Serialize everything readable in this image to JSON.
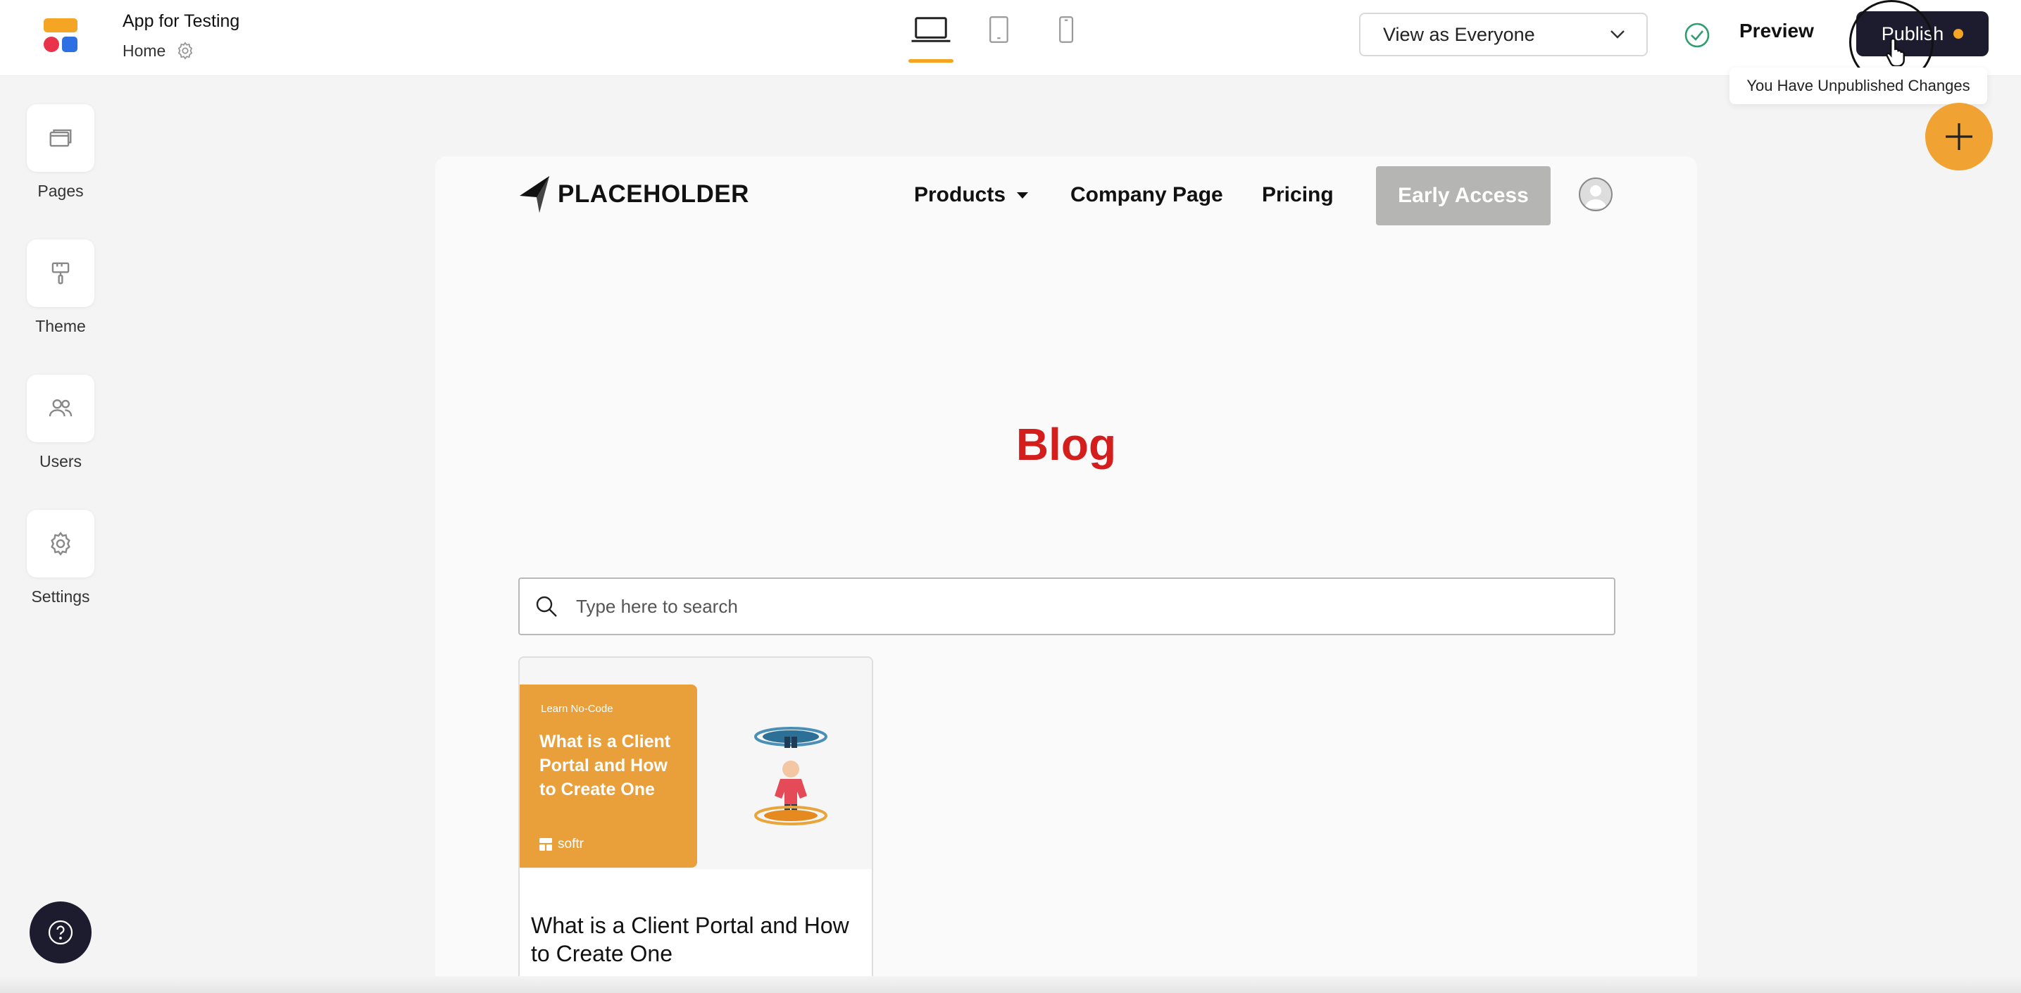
{
  "app": {
    "title": "App for Testing",
    "page": "Home"
  },
  "devices": [
    "desktop",
    "tablet",
    "mobile"
  ],
  "active_device": "desktop",
  "topbar": {
    "view_as": "View as Everyone",
    "preview_label": "Preview",
    "publish_label": "Publish",
    "tooltip": "You Have Unpublished Changes"
  },
  "sidebar": {
    "items": [
      {
        "label": "Pages",
        "icon": "pages-icon"
      },
      {
        "label": "Theme",
        "icon": "paint-roller-icon"
      },
      {
        "label": "Users",
        "icon": "users-icon"
      },
      {
        "label": "Settings",
        "icon": "gear-icon"
      }
    ]
  },
  "site": {
    "brand": "PLACEHOLDER",
    "nav": {
      "products": "Products",
      "company": "Company Page",
      "pricing": "Pricing",
      "cta": "Early Access"
    },
    "heading": "Blog",
    "search_placeholder": "Type here to search",
    "posts": [
      {
        "eyebrow": "Learn No-Code",
        "image_headline": "What is a Client Portal and How to Create One",
        "image_brand": "softr",
        "title": "What is a Client Portal and How to Create One"
      }
    ]
  },
  "colors": {
    "accent": "#f5a524",
    "publish_bg": "#1d1b2e",
    "blog_heading": "#d41e1e",
    "cta_bg": "#b5b5b3",
    "card_orange": "#e9a03a"
  }
}
